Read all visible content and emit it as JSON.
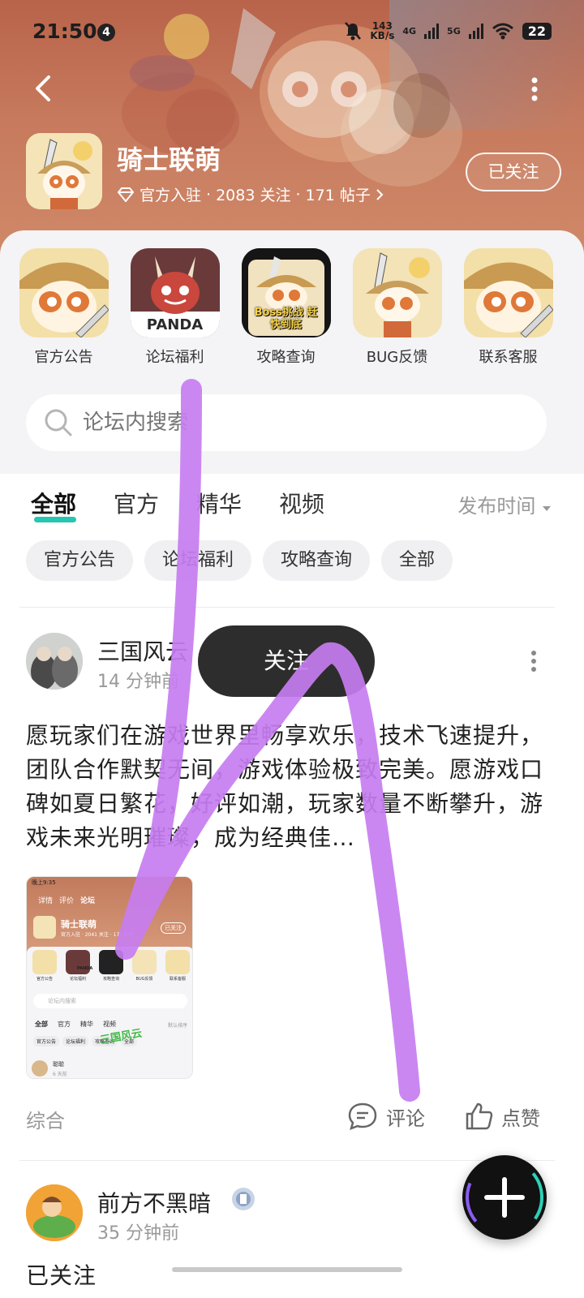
{
  "status_bar": {
    "time": "21:50",
    "notification_count": "4",
    "speed_value": "143",
    "speed_unit": "KB/s",
    "network_1": "4G",
    "network_2": "5G",
    "battery": "22"
  },
  "forum": {
    "name": "骑士联萌",
    "verified_label": "官方入驻",
    "followers": "2083 关注",
    "posts": "171 帖子",
    "separator": "·",
    "follow_state": "已关注"
  },
  "shortcuts": [
    {
      "label": "官方公告",
      "icon": "announcement-icon"
    },
    {
      "label": "论坛福利",
      "icon": "welfare-icon"
    },
    {
      "label": "攻略查询",
      "icon": "guide-icon"
    },
    {
      "label": "BUG反馈",
      "icon": "bug-feedback-icon"
    },
    {
      "label": "联系客服",
      "icon": "customer-service-icon"
    }
  ],
  "shortcut_extra": {
    "panda_text": "PANDA",
    "boss_text": "Boss挑战 赶快到底"
  },
  "search": {
    "placeholder": "论坛内搜索"
  },
  "tabs": [
    {
      "label": "全部"
    },
    {
      "label": "官方"
    },
    {
      "label": "精华"
    },
    {
      "label": "视频"
    }
  ],
  "sort_label": "发布时间",
  "chips": [
    "官方公告",
    "论坛福利",
    "攻略查询",
    "全部"
  ],
  "posts": [
    {
      "author": "三国风云",
      "time": "14 分钟前",
      "body": "愿玩家们在游戏世界里畅享欢乐，技术飞速提升，团队合作默契无间，游戏体验极致完美。愿游戏口碑如夏日繁花，好评如潮，玩家数量不断攀升，游戏未来光明璀璨，成为经典佳…",
      "tag": "综合",
      "comment_label": "评论",
      "like_label": "点赞"
    },
    {
      "author": "前方不黑暗",
      "time": "35 分钟前",
      "body_partial": "已关注"
    }
  ],
  "thumb": {
    "time": "晚上9:35",
    "tabs": [
      "详情",
      "评价",
      "论坛"
    ],
    "forum_name": "骑士联萌",
    "meta": "官方入驻 · 2041 关注 · 171 帖子",
    "follow": "已关注",
    "shortcuts": [
      "官方公告",
      "论坛福利",
      "攻略查询",
      "BUG反馈",
      "联系客服"
    ],
    "panda": "PANDA",
    "search": "论坛内搜索",
    "main_tabs": [
      "全部",
      "官方",
      "精华",
      "视频"
    ],
    "sort": "默认排序",
    "chips": [
      "官方公告",
      "论坛福利",
      "攻略查询",
      "全部"
    ],
    "watermark": "三国风云",
    "user": "聪聪",
    "user_time": "6 天前"
  },
  "toast": {
    "label": "关注"
  },
  "colors": {
    "accent": "#26c6b0",
    "scribble": "#c77df0",
    "header": "#c77a5d"
  }
}
